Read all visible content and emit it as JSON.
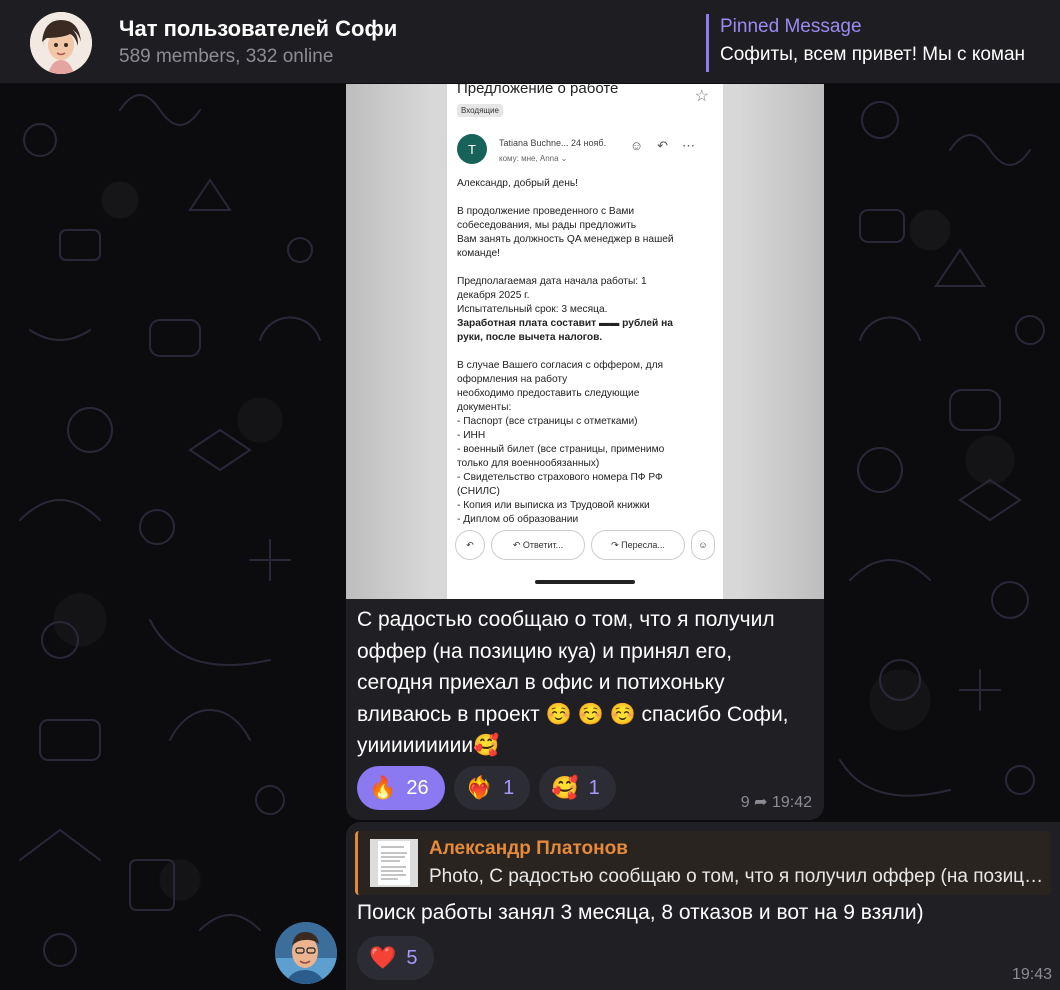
{
  "header": {
    "title": "Чат пользователей Софи",
    "subtitle": "589 members, 332 online",
    "pinned_label": "Pinned Message",
    "pinned_text": "Софиты, всем привет! Мы с коман"
  },
  "message1": {
    "photo": {
      "subject": "Предложение о работе",
      "folder": "Входящие",
      "sender_initial": "T",
      "sender": "Tatiana Buchne...  24 нояб.",
      "recipients": "кому: мне, Anna ⌄",
      "body_lines": [
        "Александр, добрый день!",
        "",
        "В продолжение проведенного с Вами",
        "собеседования, мы рады предложить",
        "Вам занять должность QA менеджер в нашей",
        "команде!",
        "",
        "Предполагаемая дата начала работы: 1",
        "декабря 2025 г.",
        "Испытательный срок: 3 месяца.",
        "Заработная плата составит ▬▬ рублей на",
        "руки, после вычета налогов.",
        "",
        "В случае Вашего согласия с оффером, для",
        "оформления на работу",
        "необходимо предоставить следующие",
        "документы:",
        "- Паспорт (все страницы с отметками)",
        "- ИНН",
        "- военный билет (все страницы, применимо",
        "только для военнообязанных)",
        "- Свидетельство страхового номера ПФ РФ",
        "(СНИЛС)",
        "- Копия или выписка из Трудовой книжки",
        "- Диплом об образовании"
      ],
      "reply_button": "Ответит...",
      "forward_button": "Пересла..."
    },
    "text": "С радостью сообщаю о том, что я получил оффер (на позицию куа) и принял его, сегодня приехал в офис и потихоньку  вливаюсь в проект ☺️ ☺️ ☺️ спасибо Софи, уиииииииии🥰",
    "reactions": [
      {
        "emoji": "🔥",
        "count": "26"
      },
      {
        "emoji": "❤️‍🔥",
        "count": "1"
      },
      {
        "emoji": "🥰",
        "count": "1"
      }
    ],
    "replies_count": "9",
    "time": "19:42"
  },
  "message2": {
    "reply_author": "Александр Платонов",
    "reply_preview": "Photo, С радостью сообщаю о том, что я получил оффер (на позицию куа) и принял его",
    "text": "Поиск работы занял 3 месяца, 8 отказов и вот на 9 взяли)",
    "reaction": {
      "emoji": "❤️",
      "count": "5"
    },
    "time": "19:43"
  },
  "colors": {
    "accent": "#8a79f0",
    "reply_accent": "#e08a3c",
    "bubble": "#1f1f24",
    "header": "#1e1e22"
  }
}
